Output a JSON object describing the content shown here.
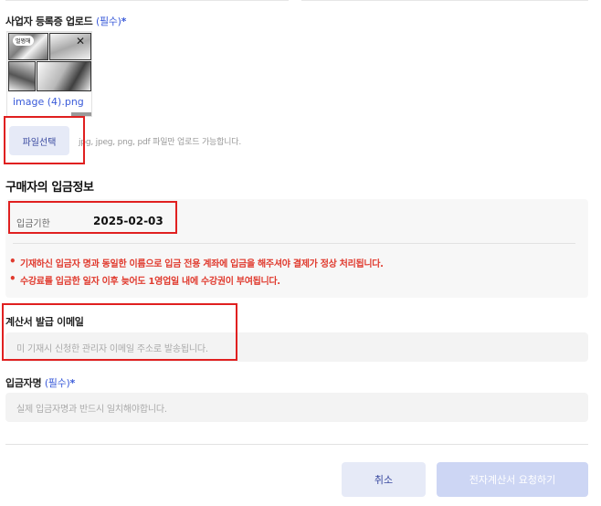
{
  "upload": {
    "label": "사업자 등록증 업로드",
    "required": "(필수)",
    "star": "*",
    "file_name": "image (4).png",
    "bubble_text": "멀쩡해",
    "close_glyph": "✕",
    "file_button": "파일선택",
    "hint": "jpg, jpeg, png, pdf 파일만 업로드 가능합니다."
  },
  "payment": {
    "title": "구매자의 입금정보",
    "due_label": "입금기한",
    "due_value": "2025-02-03",
    "notices": [
      "기재하신 입금자 명과 동일한 이름으로 입금 전용 계좌에 입금을 해주셔야 결제가 정상 처리됩니다.",
      "수강료를 입금한 일자 이후 늦어도 1영업일 내에 수강권이 부여됩니다."
    ]
  },
  "invoice_email": {
    "label": "계산서 발급 이메일",
    "placeholder": "미 기재시 신청한 관리자 이메일 주소로 발송됩니다."
  },
  "depositor": {
    "label": "입금자명",
    "required": "(필수)",
    "star": "*",
    "placeholder": "실제 입금자명과 반드시 일치해야합니다."
  },
  "actions": {
    "cancel": "취소",
    "submit": "전자계산서 요청하기"
  },
  "colors": {
    "accent": "#3a5bd9",
    "warning": "#e03a2e",
    "highlight": "#e02020",
    "button_light": "#e6eaf7",
    "button_disabled": "#cdd6f4"
  }
}
